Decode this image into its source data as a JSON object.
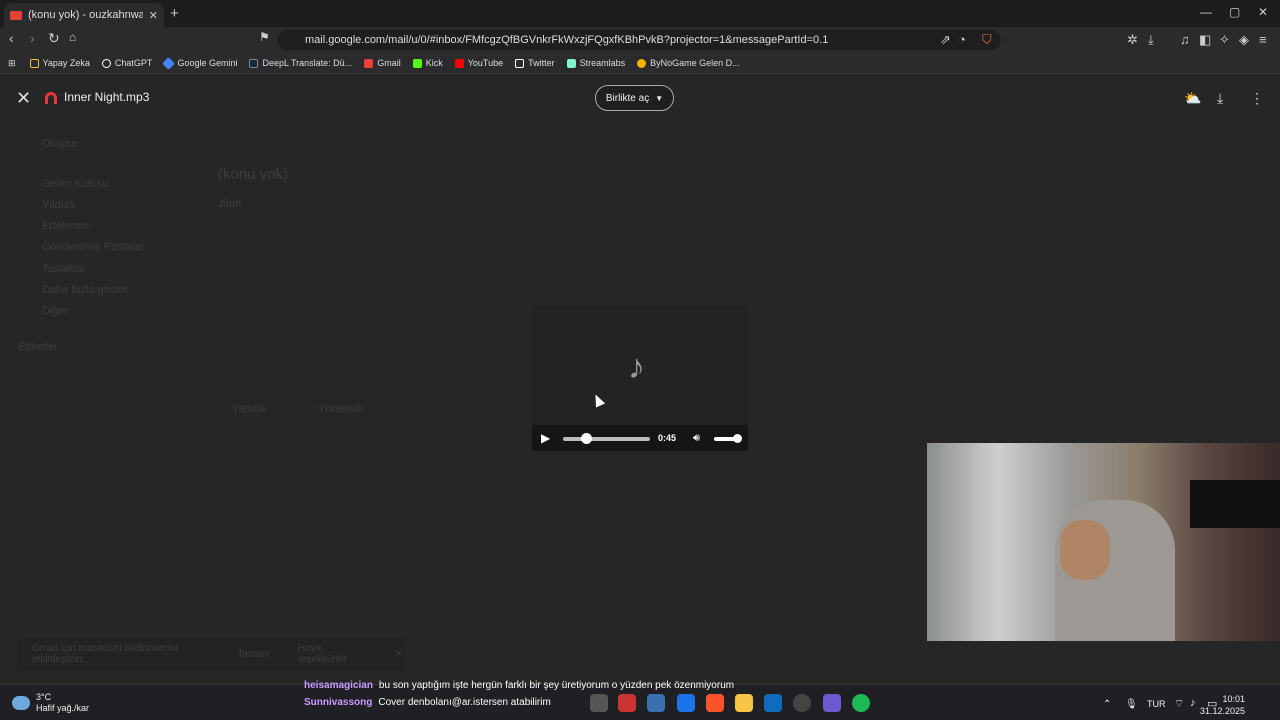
{
  "browser": {
    "tab_title": "(konu yok) - ouzkahnwaid@gm...",
    "url": "mail.google.com/mail/u/0/#inbox/FMfcgzQfBGVnkrFkWxzjFQgxfKBhPvkB?projector=1&messagePartId=0.1",
    "bookmarks": [
      "Yapay Zeka",
      "ChatGPT",
      "Google Gemini",
      "DeepL Translate: Dü...",
      "Gmail",
      "Kick",
      "YouTube",
      "Twitter",
      "Streamlabs",
      "ByNoGame Gelen D..."
    ],
    "bookmark_colors": [
      "#f1c232",
      "#ffffff",
      "#4285f4",
      "#0f2b46",
      "#ea4335",
      "#53fc18",
      "#ff0000",
      "#ffffff",
      "#80f5d2",
      "#f7b500"
    ]
  },
  "viewer": {
    "file_name": "Inner Night.mp3",
    "open_with_label": "Birlikte aç",
    "player": {
      "time": "0:45",
      "progress_fraction": 0.27,
      "volume_fraction": 0.9
    }
  },
  "gmail_background": {
    "compose": "Oluştur",
    "folders": [
      "Gelen Kutusu",
      "Yıldızlı",
      "Ertelenen",
      "Gönderilmiş Postalar",
      "Taslaklar",
      "Daha fazla göster",
      "Diğer"
    ],
    "labels_header": "Etiketler",
    "subject": "(konu yok)",
    "sender": "Jiton",
    "reply": "Yanıtla",
    "forward": "Yönlendir"
  },
  "toast": {
    "message": "Gmail için masaüstü bildirimlerini etkinleştirin.",
    "ok": "Tamam",
    "no": "Hayır, teşekkürler"
  },
  "stream_chat": [
    {
      "user": "heisamagician",
      "message": "bu son yaptığım işte hergün farklı bir şey üretiyorum o yüzden pek özenmiyorum"
    },
    {
      "user": "Sunnivassong",
      "message": "Cover denbolanı@ar.istersen atabilirim"
    }
  ],
  "taskbar": {
    "weather_temp": "3°C",
    "weather_desc": "Hafif yağ./kar",
    "language": "TUR",
    "time": "10:01",
    "date": "31.12.2025"
  }
}
